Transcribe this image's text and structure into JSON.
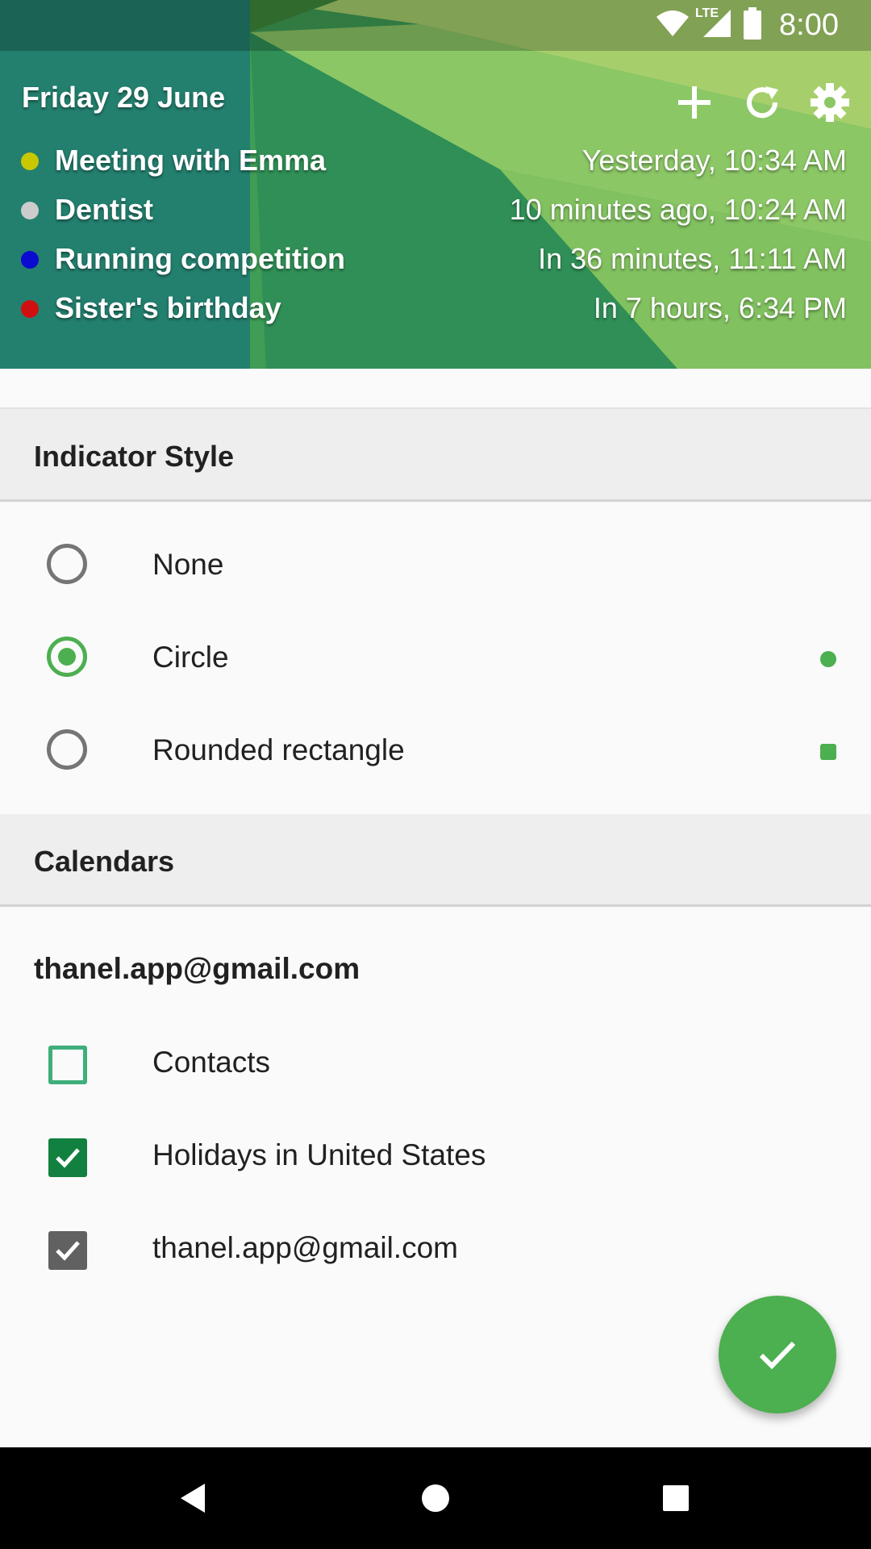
{
  "status_bar": {
    "time": "8:00",
    "network": "LTE",
    "icons": [
      "wifi-icon",
      "signal-icon",
      "battery-icon"
    ]
  },
  "widget_preview": {
    "date": "Friday 29 June",
    "toolbar_icons": [
      "add-icon",
      "refresh-icon",
      "settings-gear-icon"
    ],
    "events": [
      {
        "title": "Meeting with Emma",
        "time": "Yesterday, 10:34 AM",
        "color": "#c8c800"
      },
      {
        "title": "Dentist",
        "time": "10 minutes ago, 10:24 AM",
        "color": "#cccccc"
      },
      {
        "title": "Running competition",
        "time": "In 36 minutes, 11:11 AM",
        "color": "#0a0ad0"
      },
      {
        "title": "Sister's birthday",
        "time": "In 7 hours, 6:34 PM",
        "color": "#d01010"
      }
    ]
  },
  "indicator_style": {
    "header": "Indicator Style",
    "options": [
      {
        "label": "None",
        "selected": false,
        "preview": "none"
      },
      {
        "label": "Circle",
        "selected": true,
        "preview": "circle"
      },
      {
        "label": "Rounded rectangle",
        "selected": false,
        "preview": "rounded-rectangle"
      }
    ]
  },
  "calendars": {
    "header": "Calendars",
    "account": "thanel.app@gmail.com",
    "items": [
      {
        "label": "Contacts",
        "checked": false,
        "color": "#3fae7a"
      },
      {
        "label": "Holidays in United States",
        "checked": true,
        "color": "#12803f"
      },
      {
        "label": "thanel.app@gmail.com",
        "checked": true,
        "color": "#616161"
      }
    ]
  },
  "colors": {
    "accent": "#4caf50",
    "section_bg": "#eeeeee",
    "page_bg": "#fafafa"
  },
  "fab": {
    "icon": "check-icon"
  },
  "nav_bar": {
    "icons": [
      "back-icon",
      "home-icon",
      "recents-icon"
    ]
  }
}
